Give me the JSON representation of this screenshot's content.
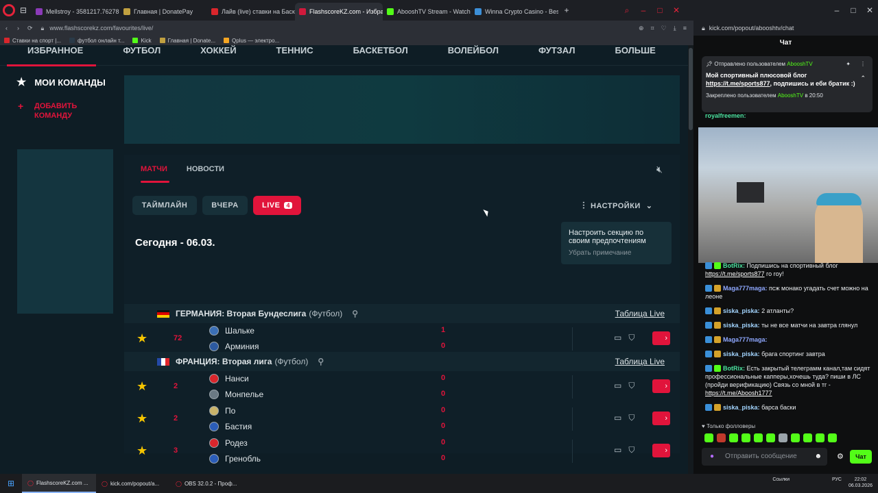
{
  "browser_tabs": [
    {
      "title": "Mellstroy - 3581217.76278",
      "color": "#8b3ab8"
    },
    {
      "title": "Главная | DonatePay",
      "color": "#c0a040"
    },
    {
      "title": "Лайв (live) ставки на Баскет",
      "color": "#d9262c"
    },
    {
      "title": "FlashscoreKZ.com - Избранное",
      "color": "#d01a3c",
      "active": true
    },
    {
      "title": "AbooshTV Stream - Watch",
      "color": "#53fc18"
    },
    {
      "title": "Winna Crypto Casino - Best",
      "color": "#3c8fd8"
    }
  ],
  "address_url": "www.flashscorekz.com/favourites/live/",
  "popup_url": "kick.com/popout/abooshtv/chat",
  "bookmarks": [
    {
      "label": "Ставки на спорт |...",
      "color": "#d9262c"
    },
    {
      "label": "футбол онлайн т...",
      "color": "#2a3a48"
    },
    {
      "label": "Kick",
      "color": "#53fc18"
    },
    {
      "label": "Главная | Donate...",
      "color": "#c0a040"
    },
    {
      "label": "Qplus — электро...",
      "color": "#f5a623"
    }
  ],
  "sport_nav": [
    "ИЗБРАННОЕ",
    "ФУТБОЛ",
    "ХОККЕЙ",
    "ТЕННИС",
    "БАСКЕТБОЛ",
    "ВОЛЕЙБОЛ",
    "ФУТЗАЛ",
    "БОЛЬШЕ"
  ],
  "sidebar": {
    "my_teams": "МОИ КОМАНДЫ",
    "add_team": "ДОБАВИТЬ КОМАНДУ"
  },
  "panel": {
    "tab_matches": "МАТЧИ",
    "tab_news": "НОВОСТИ",
    "chip_timeline": "ТАЙМЛАЙН",
    "chip_yesterday": "ВЧЕРА",
    "chip_live": "LIVE",
    "live_count": "4",
    "settings": "НАСТРОЙКИ",
    "tooltip_text": "Настроить секцию по своим предпочтениям",
    "tooltip_remove": "Убрать примечание",
    "date": "Сегодня - 06.03."
  },
  "leagues": [
    {
      "name": "ГЕРМАНИЯ: Вторая Бундеслига",
      "sport": "(Футбол)",
      "table_link": "Таблица Live",
      "matches": [
        {
          "minute": "72",
          "home": "Шальке",
          "away": "Арминия",
          "home_score": "1",
          "away_score": "0"
        }
      ]
    },
    {
      "name": "ФРАНЦИЯ: Вторая лига",
      "sport": "(Футбол)",
      "table_link": "Таблица Live",
      "matches": [
        {
          "minute": "2",
          "home": "Нанси",
          "away": "Монпелье",
          "home_score": "0",
          "away_score": "0"
        },
        {
          "minute": "2",
          "home": "По",
          "away": "Бастия",
          "home_score": "0",
          "away_score": "0"
        },
        {
          "minute": "3",
          "home": "Родез",
          "away": "Гренобль",
          "home_score": "0",
          "away_score": "0"
        }
      ]
    }
  ],
  "chat": {
    "title": "Чат",
    "pinned_sender": "Отправлено пользователем",
    "pinned_user": "AbooshTV",
    "pinned_text": "Мой спортивный плюсовой блог",
    "pinned_link": "https://t.me/sports877",
    "pinned_text2": ", подпишись и еби братик :)",
    "pinned_meta": "Закреплено пользователем",
    "pinned_meta_user": "AbooshTV",
    "pinned_meta_time": "в 20:50",
    "above_video_user": "royalfreemen:",
    "messages": [
      {
        "user": "BotRix:",
        "type": "bot",
        "text": "Подпишись на спортивный блог",
        "link": "https://t.me/sports877",
        "after": " го roy!"
      },
      {
        "user": "Maga777maga:",
        "type": "mag",
        "text": "псж монако угадать счет можно на леоне"
      },
      {
        "user": "siska_piska:",
        "type": "sis",
        "text": "2 атланты?"
      },
      {
        "user": "siska_piska:",
        "type": "sis",
        "text": "ты не все матчи на завтра глянул"
      },
      {
        "user": "Maga777maga:",
        "type": "mag",
        "text": ""
      },
      {
        "user": "siska_piska:",
        "type": "sis",
        "text": "брага спортинг завтра"
      },
      {
        "user": "BotRix:",
        "type": "bot",
        "text": "Есть закрытый телеграмм канал,там сидят профессиональные капперы,хочешь туда? пиши в ЛС (пройди верификацию) Связь со мной в тг -",
        "link": "https://t.me/Aboosh1777",
        "after": ""
      },
      {
        "user": "siska_piska:",
        "type": "sis",
        "text": "барса баски"
      }
    ],
    "followers_only": "Только фолловеры",
    "input_placeholder": "Отправить сообщение",
    "send_label": "Чат"
  },
  "taskbar": [
    {
      "label": "FlashscoreKZ.com ...",
      "active": true
    },
    {
      "label": "kick.com/popout/a...",
      "active": false
    },
    {
      "label": "OBS 32.0.2 - Проф...",
      "active": false
    }
  ],
  "tray": {
    "links": "Ссылки",
    "lang": "РУС",
    "time": "22:02",
    "date": "06.03.2026"
  }
}
